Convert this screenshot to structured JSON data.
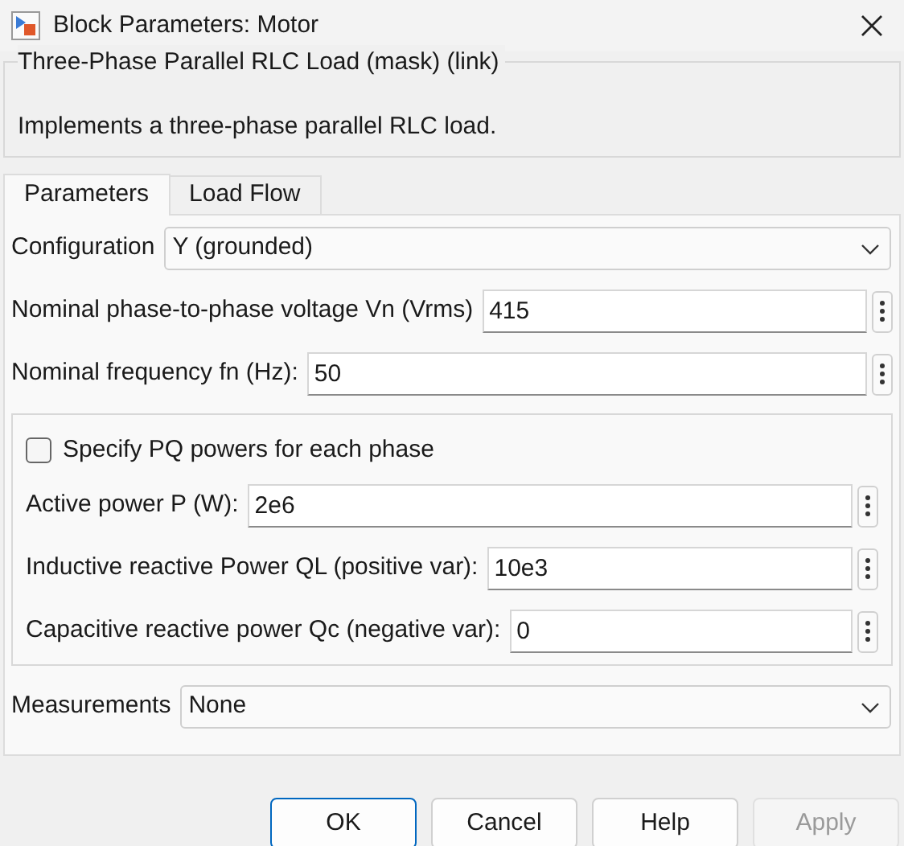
{
  "window": {
    "title": "Block Parameters: Motor"
  },
  "block": {
    "title": "Three-Phase Parallel RLC Load (mask) (link)",
    "description": "Implements a three-phase parallel RLC load."
  },
  "tabs": [
    {
      "label": "Parameters",
      "selected": true
    },
    {
      "label": "Load Flow",
      "selected": false
    }
  ],
  "parameters": [
    {
      "kind": "dropdown",
      "label": "Configuration",
      "value": "Y (grounded)"
    },
    {
      "kind": "text",
      "label": "Nominal phase-to-phase voltage Vn (Vrms)",
      "value": "415"
    },
    {
      "kind": "text",
      "label": "Nominal frequency fn (Hz):",
      "value": "50"
    }
  ],
  "power_group": {
    "checkbox": {
      "label": "Specify PQ powers for each phase",
      "checked": false
    },
    "fields": [
      {
        "label": "Active power P (W):",
        "value": "2e6"
      },
      {
        "label": "Inductive reactive Power QL (positive var):",
        "value": "10e3"
      },
      {
        "label": "Capacitive reactive power Qc (negative var):",
        "value": "0"
      }
    ]
  },
  "measurements": {
    "kind": "dropdown",
    "label": "Measurements",
    "value": "None"
  },
  "buttons": [
    {
      "label": "OK",
      "disabled": false,
      "default": true
    },
    {
      "label": "Cancel",
      "disabled": false,
      "default": false
    },
    {
      "label": "Help",
      "disabled": false,
      "default": false
    },
    {
      "label": "Apply",
      "disabled": true,
      "default": false
    }
  ]
}
